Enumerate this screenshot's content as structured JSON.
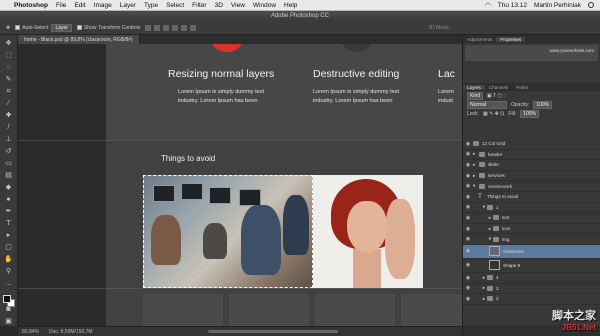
{
  "menubar": {
    "apple_icon": "apple-icon",
    "app": "Photoshop",
    "items": [
      "File",
      "Edit",
      "Image",
      "Layer",
      "Type",
      "Select",
      "Filter",
      "3D",
      "View",
      "Window",
      "Help"
    ],
    "clock": "Thu 13.12",
    "user": "Martin Perhiniak"
  },
  "titlebar": {
    "title": "Adobe Photoshop CC"
  },
  "options": {
    "auto_select": "Auto-Select:",
    "auto_select_value": "Layer",
    "show_transform": "Show Transform Controls",
    "mode_3d": "3D Mode:"
  },
  "tab": {
    "label": "home - Black.psd @ 89,8% (classroom, RGB/8#)"
  },
  "canvas": {
    "feature1_title": "Resizing normal layers",
    "feature1_body": [
      "Lorem Ipsum is simply dummy text",
      "industry. Lorem Ipsum has been"
    ],
    "feature2_title": "Destructive editing",
    "feature2_body": [
      "Lorem Ipsum is simply dummy text",
      "industry. Lorem Ipsum has been"
    ],
    "feature3_title": "Lac",
    "feature3_body": [
      "Lorem",
      "indust"
    ],
    "section_title": "Things to avoid"
  },
  "status": {
    "zoom": "89,84%",
    "doc": "Doc: 8,59M/150,7M"
  },
  "panel": {
    "top_tabs": [
      "Adjustments",
      "Properties"
    ],
    "url": "www.yourwebsite.com",
    "layer_tabs": [
      "Layers",
      "Channels",
      "Paths"
    ],
    "kind": "Kind",
    "blend": "Normal",
    "opacity_label": "Opacity:",
    "opacity": "100%",
    "lock_label": "Lock:",
    "fill_label": "Fill:",
    "fill": "100%",
    "layers": [
      {
        "name": "12 Col Grid",
        "icon": "grid-icon"
      },
      {
        "name": "header",
        "icon": "folder-icon"
      },
      {
        "name": "slider",
        "icon": "folder-icon"
      },
      {
        "name": "services",
        "icon": "folder-icon"
      },
      {
        "name": "recent-work",
        "icon": "folder-icon"
      },
      {
        "name": "Things to avoid",
        "icon": "type-icon"
      },
      {
        "name": "1",
        "icon": "folder-icon"
      },
      {
        "name": "text",
        "icon": "folder-icon"
      },
      {
        "name": "icon",
        "icon": "folder-icon"
      },
      {
        "name": "img",
        "icon": "folder-icon"
      },
      {
        "name": "classroom",
        "icon": "thumb",
        "selected": true
      },
      {
        "name": "Shape 8",
        "icon": "thumb"
      },
      {
        "name": "4",
        "icon": "folder-icon"
      },
      {
        "name": "3",
        "icon": "folder-icon"
      },
      {
        "name": "2",
        "icon": "folder-icon"
      }
    ]
  },
  "watermark": {
    "line1": "脚本之家",
    "line2": "JB51.Net"
  },
  "colors": {
    "accent_red": "#d9342b",
    "selection_blue": "#5c7aa0"
  }
}
